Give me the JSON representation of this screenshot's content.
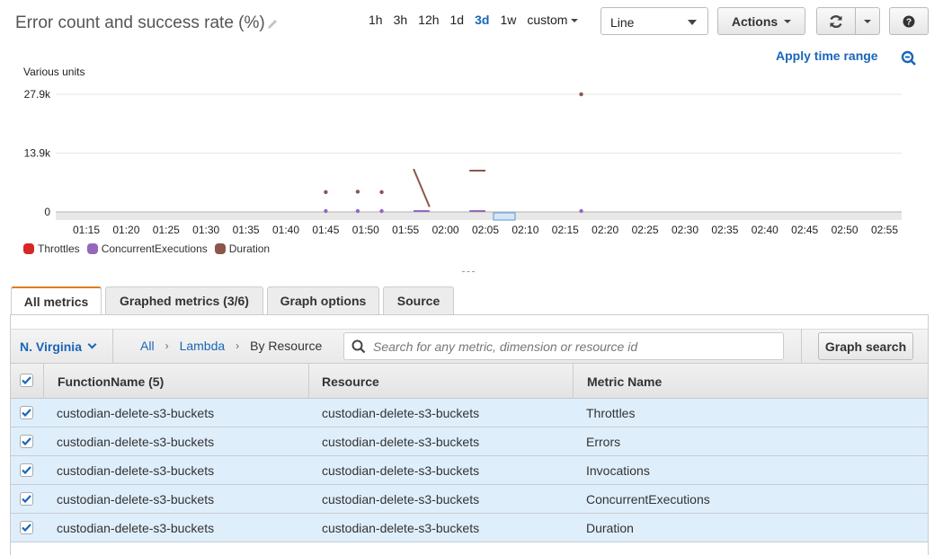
{
  "header": {
    "title": "Error count and success rate (%)",
    "time_ranges": [
      "1h",
      "3h",
      "12h",
      "1d",
      "3d",
      "1w",
      "custom"
    ],
    "active_range": "3d",
    "chart_type_select": "Line",
    "actions_label": "Actions",
    "apply_time_range": "Apply time range"
  },
  "colors": {
    "accent_link": "#1a66b8",
    "active_tab": "#e07b22",
    "row_selected": "#dfeefb"
  },
  "chart_data": {
    "type": "line",
    "ylabel": "Various units",
    "yticks": [
      "0",
      "13.9k",
      "27.9k"
    ],
    "ylim": [
      0,
      27900
    ],
    "xticks": [
      "01:15",
      "01:20",
      "01:25",
      "01:30",
      "01:35",
      "01:40",
      "01:45",
      "01:50",
      "01:55",
      "02:00",
      "02:05",
      "02:10",
      "02:15",
      "02:20",
      "02:25",
      "02:30",
      "02:35",
      "02:40",
      "02:45",
      "02:50",
      "02:55"
    ],
    "xrange_minutes": [
      73,
      178
    ],
    "legend_position": "bottom-left",
    "series": [
      {
        "name": "Throttles",
        "color": "#d62728",
        "points": []
      },
      {
        "name": "ConcurrentExecutions",
        "color": "#9467bd",
        "points": [
          {
            "x": "01:45",
            "y": 0
          },
          {
            "x": "01:49",
            "y": 0
          },
          {
            "x": "01:52",
            "y": 0
          },
          {
            "x": "01:56",
            "y": 0
          },
          {
            "x": "01:58",
            "y": 0
          },
          {
            "x": "02:03",
            "y": 0
          },
          {
            "x": "02:05",
            "y": 0
          },
          {
            "x": "02:17",
            "y": 0
          }
        ],
        "segments": [
          [
            0
          ],
          [
            1
          ],
          [
            2
          ],
          [
            3,
            4
          ],
          [
            5,
            6
          ],
          [
            7
          ]
        ]
      },
      {
        "name": "Duration",
        "color": "#8c564b",
        "points": [
          {
            "x": "01:45",
            "y": 4700
          },
          {
            "x": "01:49",
            "y": 4800
          },
          {
            "x": "01:52",
            "y": 4700
          },
          {
            "x": "01:56",
            "y": 10200
          },
          {
            "x": "01:58",
            "y": 1200
          },
          {
            "x": "02:03",
            "y": 9800
          },
          {
            "x": "02:05",
            "y": 9800
          },
          {
            "x": "02:17",
            "y": 27900
          }
        ],
        "segments": [
          [
            0
          ],
          [
            1
          ],
          [
            2
          ],
          [
            3,
            4
          ],
          [
            5,
            6
          ],
          [
            7
          ]
        ]
      }
    ]
  },
  "tabs": [
    {
      "label": "All metrics",
      "active": true
    },
    {
      "label": "Graphed metrics (3/6)",
      "active": false
    },
    {
      "label": "Graph options",
      "active": false
    },
    {
      "label": "Source",
      "active": false
    }
  ],
  "browser": {
    "region": "N. Virginia",
    "breadcrumb": [
      "All",
      "Lambda",
      "By Resource"
    ],
    "search_placeholder": "Search for any metric, dimension or resource id",
    "graph_search_label": "Graph search"
  },
  "table": {
    "columns": [
      "FunctionName (5)",
      "Resource",
      "Metric Name"
    ],
    "rows": [
      {
        "checked": true,
        "function": "custodian-delete-s3-buckets",
        "resource": "custodian-delete-s3-buckets",
        "metric": "Throttles"
      },
      {
        "checked": true,
        "function": "custodian-delete-s3-buckets",
        "resource": "custodian-delete-s3-buckets",
        "metric": "Errors"
      },
      {
        "checked": true,
        "function": "custodian-delete-s3-buckets",
        "resource": "custodian-delete-s3-buckets",
        "metric": "Invocations"
      },
      {
        "checked": true,
        "function": "custodian-delete-s3-buckets",
        "resource": "custodian-delete-s3-buckets",
        "metric": "ConcurrentExecutions"
      },
      {
        "checked": true,
        "function": "custodian-delete-s3-buckets",
        "resource": "custodian-delete-s3-buckets",
        "metric": "Duration"
      }
    ]
  }
}
